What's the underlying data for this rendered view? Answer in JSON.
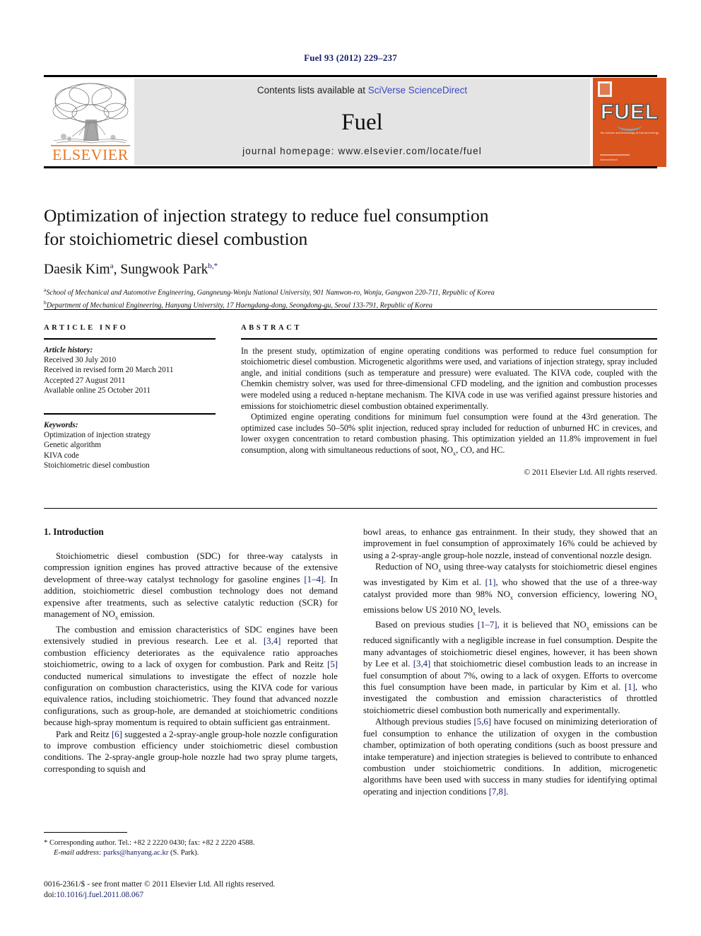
{
  "running_head": "Fuel 93 (2012) 229–237",
  "masthead": {
    "publisher_name": "ELSEVIER",
    "contents_prefix": "Contents lists available at ",
    "contents_link": "SciVerse ScienceDirect",
    "journal_title": "Fuel",
    "homepage": "journal homepage: www.elsevier.com/locate/fuel",
    "cover": {
      "title": "FUEL",
      "subtitle": "the science and technology of fuel and energy",
      "footer": "ScienceDirect"
    }
  },
  "article": {
    "title_line1": "Optimization of injection strategy to reduce fuel consumption",
    "title_line2": "for stoichiometric diesel combustion",
    "authors": [
      {
        "name": "Daesik Kim",
        "sup": "a"
      },
      {
        "name": "Sungwook Park",
        "sup": "b,*"
      }
    ],
    "affiliations": [
      {
        "sup": "a",
        "text": "School of Mechanical and Automotive Engineering, Gangneung-Wonju National University, 901 Namwon-ro, Wonju, Gangwon 220-711, Republic of Korea"
      },
      {
        "sup": "b",
        "text": "Department of Mechanical Engineering, Hanyang University, 17 Haengdang-dong, Seongdong-gu, Seoul 133-791, Republic of Korea"
      }
    ]
  },
  "article_info": {
    "label": "ARTICLE INFO",
    "history_label": "Article history:",
    "history": [
      "Received 30 July 2010",
      "Received in revised form 20 March 2011",
      "Accepted 27 August 2011",
      "Available online 25 October 2011"
    ],
    "keywords_label": "Keywords:",
    "keywords": [
      "Optimization of injection strategy",
      "Genetic algorithm",
      "KIVA code",
      "Stoichiometric diesel combustion"
    ]
  },
  "abstract": {
    "label": "ABSTRACT",
    "paragraph1": "In the present study, optimization of engine operating conditions was performed to reduce fuel consumption for stoichiometric diesel combustion. Microgenetic algorithms were used, and variations of injection strategy, spray included angle, and initial conditions (such as temperature and pressure) were evaluated. The KIVA code, coupled with the Chemkin chemistry solver, was used for three-dimensional CFD modeling, and the ignition and combustion processes were modeled using a reduced n-heptane mechanism. The KIVA code in use was verified against pressure histories and emissions for stoichiometric diesel combustion obtained experimentally.",
    "paragraph2_a": "Optimized engine operating conditions for minimum fuel consumption were found at the 43rd generation. The optimized case includes 50–50% split injection, reduced spray included for reduction of unburned HC in crevices, and lower oxygen concentration to retard combustion phasing. This optimization yielded an 11.8% improvement in fuel consumption, along with simultaneous reductions of soot, NO",
    "paragraph2_sub": "x",
    "paragraph2_b": ", CO, and HC.",
    "copyright": "© 2011 Elsevier Ltd. All rights reserved."
  },
  "introduction": {
    "heading": "1. Introduction",
    "left_paragraphs": [
      {
        "parts": [
          {
            "t": "Stoichiometric diesel combustion (SDC) for three-way catalysts in compression ignition engines has proved attractive because of the extensive development of three-way catalyst technology for gasoline engines "
          },
          {
            "t": "[1–4]",
            "ref": true
          },
          {
            "t": ". In addition, stoichiometric diesel combustion technology does not demand expensive after treatments, such as selective catalytic reduction (SCR) for management of NO"
          },
          {
            "t": "x",
            "sub": true
          },
          {
            "t": " emission."
          }
        ]
      },
      {
        "parts": [
          {
            "t": "The combustion and emission characteristics of SDC engines have been extensively studied in previous research. Lee et al. "
          },
          {
            "t": "[3,4]",
            "ref": true
          },
          {
            "t": " reported that combustion efficiency deteriorates as the equivalence ratio approaches stoichiometric, owing to a lack of oxygen for combustion. Park and Reitz "
          },
          {
            "t": "[5]",
            "ref": true
          },
          {
            "t": " conducted numerical simulations to investigate the effect of nozzle hole configuration on combustion characteristics, using the KIVA code for various equivalence ratios, including stoichiometric. They found that advanced nozzle configurations, such as group-hole, are demanded at stoichiometric conditions because high-spray momentum is required to obtain sufficient gas entrainment."
          }
        ]
      },
      {
        "parts": [
          {
            "t": "Park and Reitz "
          },
          {
            "t": "[6]",
            "ref": true
          },
          {
            "t": " suggested a 2-spray-angle group-hole nozzle configuration to improve combustion efficiency under stoichiometric diesel combustion conditions. The 2-spray-angle group-hole nozzle had two spray plume targets, corresponding to squish and"
          }
        ]
      }
    ],
    "right_paragraphs": [
      {
        "parts": [
          {
            "t": "bowl areas, to enhance gas entrainment. In their study, they showed that an improvement in fuel consumption of approximately 16% could be achieved by using a 2-spray-angle group-hole nozzle, instead of conventional nozzle design."
          }
        ],
        "no_indent": true
      },
      {
        "parts": [
          {
            "t": "Reduction of NO"
          },
          {
            "t": "x",
            "sub": true
          },
          {
            "t": " using three-way catalysts for stoichiometric diesel engines was investigated by Kim et al. "
          },
          {
            "t": "[1]",
            "ref": true
          },
          {
            "t": ", who showed that the use of a three-way catalyst provided more than 98% NO"
          },
          {
            "t": "x",
            "sub": true
          },
          {
            "t": " conversion efficiency, lowering NO"
          },
          {
            "t": "x",
            "sub": true
          },
          {
            "t": " emissions below US 2010 NO"
          },
          {
            "t": "x",
            "sub": true
          },
          {
            "t": " levels."
          }
        ]
      },
      {
        "parts": [
          {
            "t": "Based on previous studies "
          },
          {
            "t": "[1–7]",
            "ref": true
          },
          {
            "t": ", it is believed that NO"
          },
          {
            "t": "x",
            "sub": true
          },
          {
            "t": " emissions can be reduced significantly with a negligible increase in fuel consumption. Despite the many advantages of stoichiometric diesel engines, however, it has been shown by Lee et al. "
          },
          {
            "t": "[3,4]",
            "ref": true
          },
          {
            "t": " that stoichiometric diesel combustion leads to an increase in fuel consumption of about 7%, owing to a lack of oxygen. Efforts to overcome this fuel consumption have been made, in particular by Kim et al. "
          },
          {
            "t": "[1]",
            "ref": true
          },
          {
            "t": ", who investigated the combustion and emission characteristics of throttled stoichiometric diesel combustion both numerically and experimentally."
          }
        ]
      },
      {
        "parts": [
          {
            "t": "Although previous studies "
          },
          {
            "t": "[5,6]",
            "ref": true
          },
          {
            "t": " have focused on minimizing deterioration of fuel consumption to enhance the utilization of oxygen in the combustion chamber, optimization of both operating conditions (such as boost pressure and intake temperature) and injection strategies is believed to contribute to enhanced combustion under stoichiometric conditions. In addition, microgenetic algorithms have been used with success in many studies for identifying optimal operating and injection conditions "
          },
          {
            "t": "[7,8]",
            "ref": true
          },
          {
            "t": "."
          }
        ]
      }
    ]
  },
  "footnote": {
    "corresponding": "* Corresponding author. Tel.: +82 2 2220 0430; fax: +82 2 2220 4588.",
    "email_label": "E-mail address:",
    "email": "parks@hanyang.ac.kr",
    "email_suffix": "(S. Park)."
  },
  "issn": {
    "line1": "0016-2361/$ - see front matter © 2011 Elsevier Ltd. All rights reserved.",
    "doi_label": "doi:",
    "doi_value": "10.1016/j.fuel.2011.08.067"
  }
}
